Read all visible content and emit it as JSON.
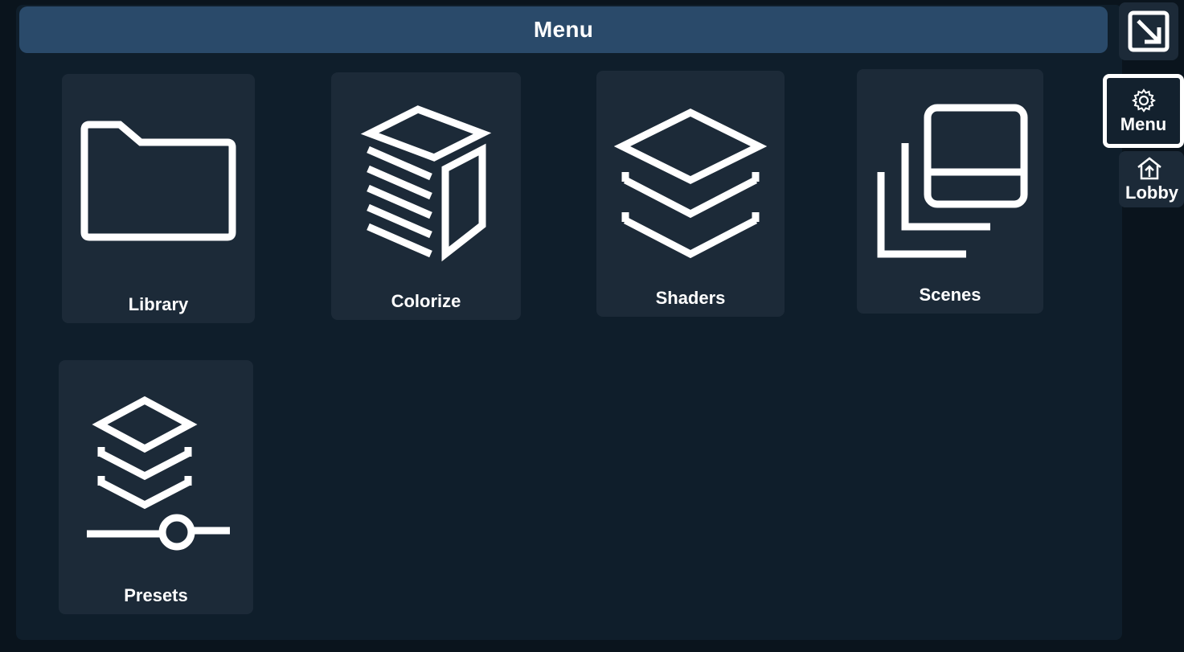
{
  "window": {
    "title": "Menu"
  },
  "tiles": [
    {
      "label": "Library",
      "icon": "folder-icon"
    },
    {
      "label": "Colorize",
      "icon": "cube-slices-icon"
    },
    {
      "label": "Shaders",
      "icon": "layers-icon"
    },
    {
      "label": "Scenes",
      "icon": "stacked-frames-icon"
    },
    {
      "label": "Presets",
      "icon": "layers-slider-icon"
    }
  ],
  "sidebar": {
    "buttons": [
      {
        "label": "",
        "icon": "collapse-arrow-icon"
      },
      {
        "label": "Menu",
        "icon": "gear-icon",
        "active": true
      },
      {
        "label": "Lobby",
        "icon": "home-exit-icon"
      }
    ]
  },
  "colors": {
    "header": "#2a4a6a",
    "panel": "#0f1e2b",
    "tile": "#1c2a38",
    "accent": "#ffffff"
  }
}
